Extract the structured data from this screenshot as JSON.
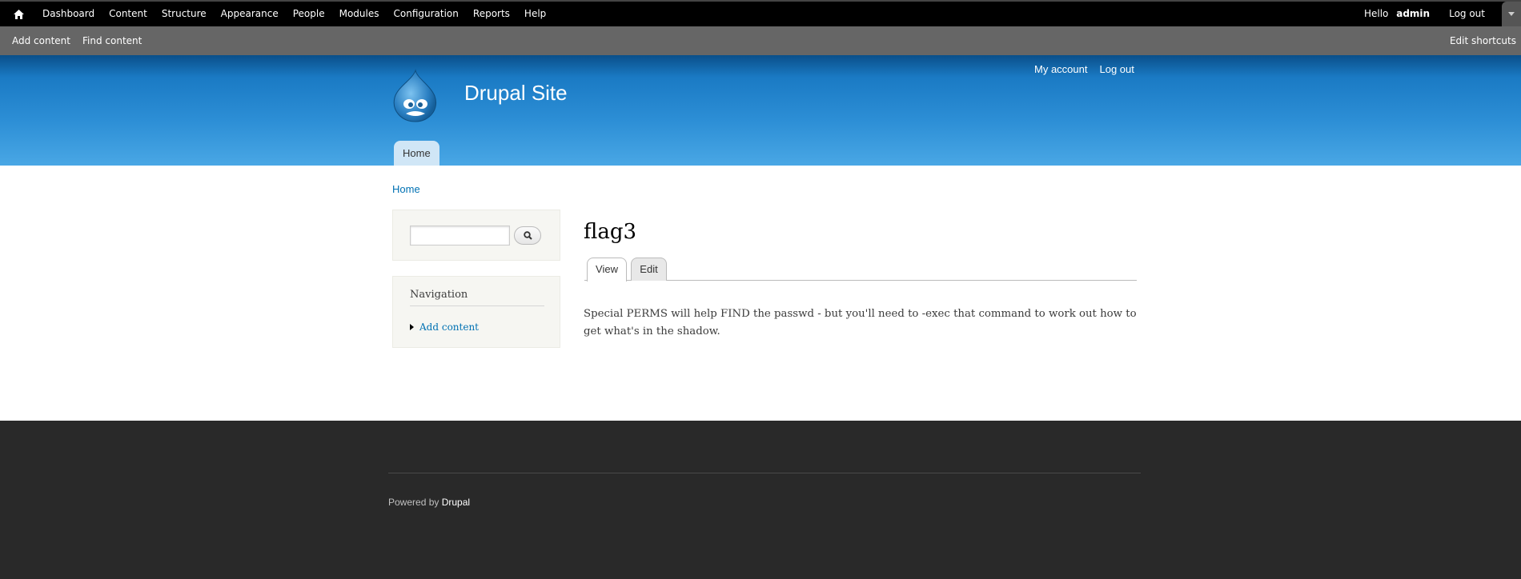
{
  "toolbar": {
    "menu": [
      "Dashboard",
      "Content",
      "Structure",
      "Appearance",
      "People",
      "Modules",
      "Configuration",
      "Reports",
      "Help"
    ],
    "hello": "Hello",
    "username": "admin",
    "logout": "Log out",
    "shortcuts": [
      "Add content",
      "Find content"
    ],
    "edit_shortcuts": "Edit shortcuts"
  },
  "header": {
    "site_name": "Drupal Site",
    "secondary_menu": [
      "My account",
      "Log out"
    ],
    "main_menu": [
      "Home"
    ]
  },
  "breadcrumb": "Home",
  "search": {
    "value": "",
    "placeholder": ""
  },
  "navigation": {
    "title": "Navigation",
    "items": [
      "Add content"
    ]
  },
  "page": {
    "title": "flag3",
    "tabs": [
      "View",
      "Edit"
    ],
    "body": "Special PERMS will help FIND the passwd - but you'll need to -exec that command to work out how to get what's in the shadow."
  },
  "footer": {
    "powered_by": "Powered by",
    "drupal_link": "Drupal"
  },
  "colors": {
    "toolbar": "#000000",
    "shortcuts_bar": "#666666",
    "header_top": "#0a4f8a",
    "header_bottom": "#49a7e5",
    "link": "#0071b3",
    "footer": "#292929"
  }
}
